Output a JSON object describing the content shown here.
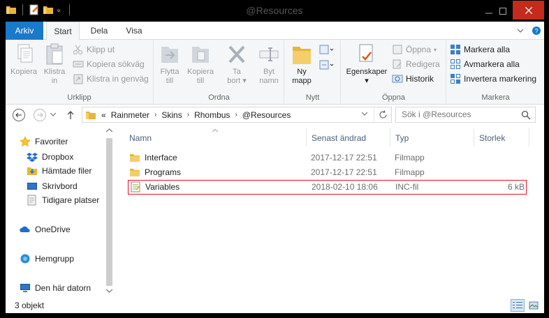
{
  "window": {
    "title": "@Resources"
  },
  "ribbon_tabs": {
    "file": "Arkiv",
    "start": "Start",
    "share": "Dela",
    "view": "Visa"
  },
  "ribbon": {
    "clipboard": {
      "copy": "Kopiera",
      "pin_line1": "Klistra",
      "pin_line2": "in",
      "cut": "Klipp ut",
      "copy_path": "Kopiera sökväg",
      "paste_shortcut": "Klistra in genväg",
      "label": "Urklipp"
    },
    "organize": {
      "move_line1": "Flytta",
      "move_line2": "till",
      "copy_line1": "Kopiera",
      "copy_line2": "till",
      "delete_line1": "Ta",
      "delete_line2": "bort",
      "rename_line1": "Byt",
      "rename_line2": "namn",
      "label": "Ordna"
    },
    "new": {
      "folder_line1": "Ny",
      "folder_line2": "mapp",
      "label": "Nytt"
    },
    "open": {
      "properties": "Egenskaper",
      "open": "Öppna",
      "edit": "Redigera",
      "history": "Historik",
      "label": "Öppna"
    },
    "select": {
      "select_all": "Markera alla",
      "select_none": "Avmarkera alla",
      "invert": "Invertera markering",
      "label": "Markera"
    }
  },
  "address": {
    "overflow": "«",
    "crumbs": [
      "Rainmeter",
      "Skins",
      "Rhombus",
      "@Resources"
    ],
    "search_placeholder": "Sök i @Resources"
  },
  "nav": {
    "favorites": "Favoriter",
    "dropbox": "Dropbox",
    "downloads": "Hämtade filer",
    "desktop": "Skrivbord",
    "recent": "Tidigare platser",
    "onedrive": "OneDrive",
    "homegroup": "Hemgrupp",
    "thispc": "Den här datorn"
  },
  "columns": {
    "name": "Namn",
    "modified": "Senast ändrad",
    "type": "Typ",
    "size": "Storlek"
  },
  "files": [
    {
      "name": "Interface",
      "modified": "2017-12-17 22:51",
      "type": "Filmapp",
      "size": ""
    },
    {
      "name": "Programs",
      "modified": "2017-12-17 22:51",
      "type": "Filmapp",
      "size": ""
    },
    {
      "name": "Variables",
      "modified": "2018-02-10 18:06",
      "type": "INC-fil",
      "size": "6 kB"
    }
  ],
  "status": {
    "count": "3 objekt"
  },
  "colors": {
    "accent": "#1979ca",
    "close": "#c42b1c",
    "highlight": "#e81123",
    "folder": "#e8b53a"
  }
}
